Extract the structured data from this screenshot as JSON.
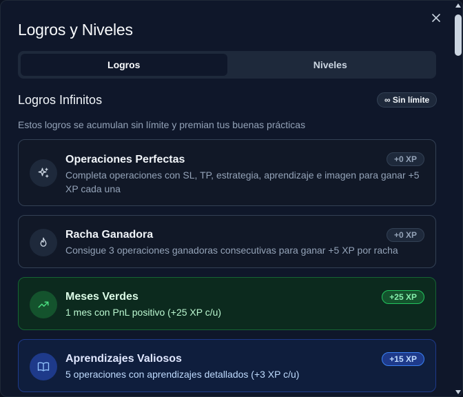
{
  "dialog": {
    "title": "Logros y Niveles",
    "close_icon": "close-icon"
  },
  "tabs": [
    {
      "label": "Logros",
      "active": true
    },
    {
      "label": "Niveles",
      "active": false
    }
  ],
  "section": {
    "title": "Logros Infinitos",
    "badge": "∞ Sin límite",
    "description": "Estos logros se acumulan sin límite y premian tus buenas prácticas"
  },
  "achievements": [
    {
      "icon": "sparkles-icon",
      "title": "Operaciones Perfectas",
      "description": "Completa operaciones con SL, TP, estrategia, aprendizaje e imagen para ganar +5 XP cada una",
      "xp": "+0 XP",
      "variant": "neutral"
    },
    {
      "icon": "flame-icon",
      "title": "Racha Ganadora",
      "description": "Consigue 3 operaciones ganadoras consecutivas para ganar +5 XP por racha",
      "xp": "+0 XP",
      "variant": "neutral"
    },
    {
      "icon": "trending-up-icon",
      "title": "Meses Verdes",
      "description": "1 mes con PnL positivo (+25 XP c/u)",
      "xp": "+25 XP",
      "variant": "green"
    },
    {
      "icon": "book-open-icon",
      "title": "Aprendizajes Valiosos",
      "description": "5 operaciones con aprendizajes detallados (+3 XP c/u)",
      "xp": "+15 XP",
      "variant": "blue"
    }
  ],
  "colors": {
    "background": "#0f172a",
    "green_accent": "#22c55e",
    "blue_accent": "#3b82f6"
  }
}
